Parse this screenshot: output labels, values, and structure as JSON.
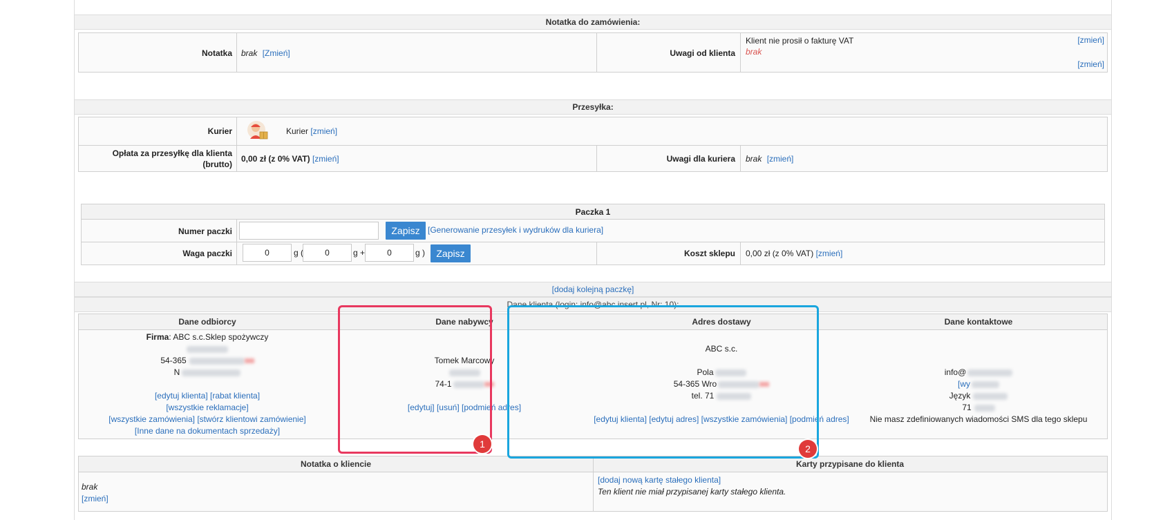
{
  "order_note": {
    "header": "Notatka do zamówienia:",
    "note_label": "Notatka",
    "note_value": "brak",
    "note_change": "[Zmień]",
    "client_remarks_label": "Uwagi od klienta",
    "vat_text": "Klient nie prosił o fakturę VAT",
    "remarks_value": "brak",
    "change_link": "[zmień]",
    "change_link2": "[zmień]"
  },
  "shipment": {
    "header": "Przesyłka:",
    "courier_label": "Kurier",
    "courier_value": "Kurier",
    "courier_change": "[zmień]",
    "fee_label": "Opłata za przesyłkę dla klienta (brutto)",
    "fee_value": "0,00 zł (z 0% VAT)",
    "fee_change": "[zmień]",
    "courier_notes_label": "Uwagi dla kuriera",
    "courier_notes_value": "brak",
    "courier_notes_change": "[zmień]"
  },
  "package": {
    "header": "Paczka 1",
    "number_label": "Numer paczki",
    "number_value": "",
    "save_label": "Zapisz",
    "generate_link": "[Generowanie przesyłek i wydruków dla kuriera]",
    "weight_label": "Waga paczki",
    "weight_values": [
      "0",
      "0",
      "0"
    ],
    "unit_g1": "g (",
    "unit_g2": "g +",
    "unit_g3": "g )",
    "save_label2": "Zapisz",
    "shop_cost_label": "Koszt sklepu",
    "shop_cost_value": "0,00 zł (z 0% VAT)",
    "shop_cost_change": "[zmień]",
    "add_package": "[dodaj kolejną paczkę]"
  },
  "client": {
    "header": "Dane klienta (login: info@abc.insert.pl, Nr: 10):",
    "recipient": {
      "title": "Dane odbiorcy",
      "company_label": "Firma",
      "company_value": ": ABC s.c.Sklep spożywczy",
      "zip": "54-365",
      "n_line": "N",
      "links": [
        "[edytuj klienta]",
        "[rabat klienta]",
        "[wszystkie reklamacje]",
        "[wszystkie zamówienia]",
        "[stwórz klientowi zamówienie]",
        "[Inne dane na dokumentach sprzedaży]"
      ]
    },
    "buyer": {
      "title": "Dane nabywcy",
      "name": "Tomek Marcowy",
      "zip": "74-1",
      "links": [
        "[edytuj]",
        "[usuń]",
        "[podmień adres]"
      ]
    },
    "delivery": {
      "title": "Adres dostawy",
      "company": "ABC s.c.",
      "street": "Pola",
      "city": "54-365 Wro",
      "tel": "tel. 71",
      "links": [
        "[edytuj klienta]",
        "[edytuj adres]",
        "[wszystkie zamówienia]",
        "[podmień adres]"
      ]
    },
    "contact": {
      "title": "Dane kontaktowe",
      "email": "info@",
      "wy": "[wy",
      "lang": "Język",
      "phone": "71",
      "sms_text": "Nie masz zdefiniowanych wiadomości SMS dla tego sklepu"
    }
  },
  "client_note": {
    "header": "Notatka o kliencie",
    "value": "brak",
    "change": "[zmień]"
  },
  "cards": {
    "header": "Karty przypisane do klienta",
    "add_link": "[dodaj nową kartę stałego klienta]",
    "none_text": "Ten klient nie miał przypisanej karty stałego klienta."
  },
  "annotations": {
    "badge1": "1",
    "badge2": "2",
    "color1": "#e8385f",
    "color2": "#1aa6de"
  }
}
